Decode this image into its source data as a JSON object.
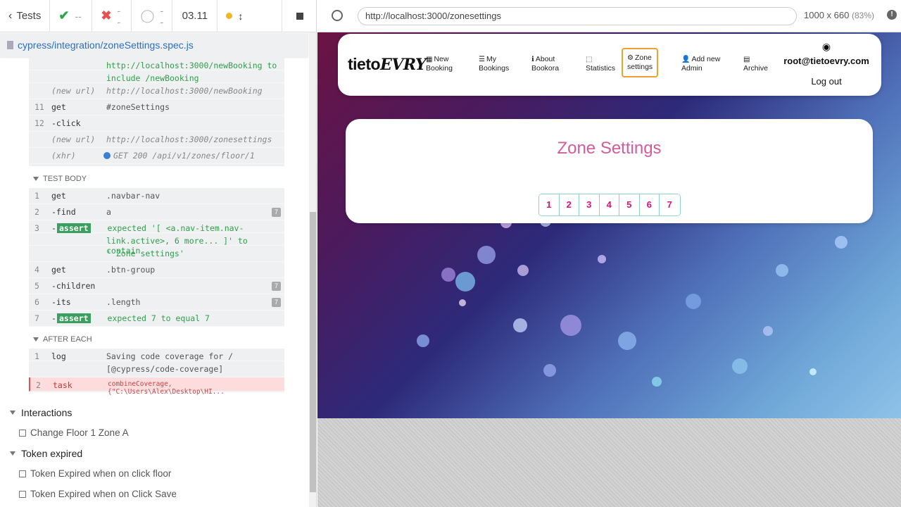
{
  "runner": {
    "tests_label": "Tests",
    "passed": "--",
    "failed": "--",
    "pending": "--",
    "duration": "03.11",
    "spec_path": "cypress/integration/zoneSettings.spec.js"
  },
  "log": {
    "pre": [
      {
        "num": "",
        "name": "",
        "msg": "http://localhost:3000/newBooking  to",
        "cls": "g2"
      },
      {
        "num": "",
        "name": "",
        "msg": "include  /newBooking",
        "cls": "g2"
      },
      {
        "num": "",
        "name": "(new url)",
        "msg": "http://localhost:3000/newBooking",
        "cls": "it"
      },
      {
        "num": "11",
        "name": "get",
        "msg": "#zoneSettings",
        "cls": ""
      },
      {
        "num": "12",
        "name": " -click",
        "msg": "",
        "cls": ""
      },
      {
        "num": "",
        "name": "(new url)",
        "msg": "http://localhost:3000/zonesettings",
        "cls": "it"
      },
      {
        "num": "",
        "name": "(xhr)",
        "msg": "GET 200 /api/v1/zones/floor/1",
        "cls": "it"
      }
    ],
    "test_body_label": "TEST BODY",
    "body": [
      {
        "num": "1",
        "name": "get",
        "msg": ".navbar-nav"
      },
      {
        "num": "2",
        "name": " -find",
        "msg": "a",
        "badge": "7"
      },
      {
        "num": "3",
        "name": " -",
        "assert": "assert",
        "msg": "expected  '[ <a.nav-item.nav-"
      },
      {
        "num": "",
        "name": "",
        "msg": "link.active>, 6 more... ]'  to contain"
      },
      {
        "num": "",
        "name": "",
        "msg": "' Zone settings'"
      },
      {
        "num": "4",
        "name": "get",
        "msg": ".btn-group"
      },
      {
        "num": "5",
        "name": " -children",
        "msg": "",
        "badge": "7"
      },
      {
        "num": "6",
        "name": " -its",
        "msg": ".length",
        "badge": "7"
      },
      {
        "num": "7",
        "name": " -",
        "assert": "assert",
        "msg": "expected  7  to equal  7"
      }
    ],
    "after_each_label": "AFTER EACH",
    "after": [
      {
        "num": "1",
        "name": "log",
        "msg": "Saving code coverage for  /"
      },
      {
        "num": "",
        "name": "",
        "msg": "[@cypress/code-coverage]"
      },
      {
        "num": "2",
        "name": "task",
        "msg": "combineCoverage, {\"C:\\Users\\Alex\\Desktop\\HI..."
      }
    ]
  },
  "suites": [
    {
      "name": "Interactions",
      "tests": [
        "Change Floor 1 Zone A"
      ]
    },
    {
      "name": "Token expired",
      "tests": [
        "Token Expired when on click floor",
        "Token Expired when on Click Save"
      ]
    }
  ],
  "browser": {
    "url": "http://localhost:3000/zonesettings",
    "viewport": "1000 x 660",
    "zoom": "(83%)"
  },
  "app": {
    "logo_a": "tieto",
    "logo_b": "EVRY",
    "nav": [
      {
        "icon": "calendar",
        "line1": "New",
        "line2": "Booking"
      },
      {
        "icon": "list",
        "line1": "My",
        "line2": "Bookings"
      },
      {
        "icon": "info",
        "line1": "About",
        "line2": "Bookora"
      },
      {
        "icon": "chart",
        "line1": "",
        "line2": "Statistics"
      },
      {
        "icon": "gear",
        "line1": "Zone",
        "line2": "settings"
      },
      {
        "icon": "user-plus",
        "line1": "Add new",
        "line2": "Admin"
      },
      {
        "icon": "table",
        "line1": "",
        "line2": "Archive"
      }
    ],
    "user_email": "root@tietoevry.com",
    "logout": "Log out",
    "page_title": "Zone Settings",
    "floors": [
      "1",
      "2",
      "3",
      "4",
      "5",
      "6",
      "7"
    ]
  },
  "colors": {
    "accent_pink": "#d45b99",
    "floor_text": "#d4147d",
    "pass": "#27a844",
    "fail": "#e45252"
  }
}
